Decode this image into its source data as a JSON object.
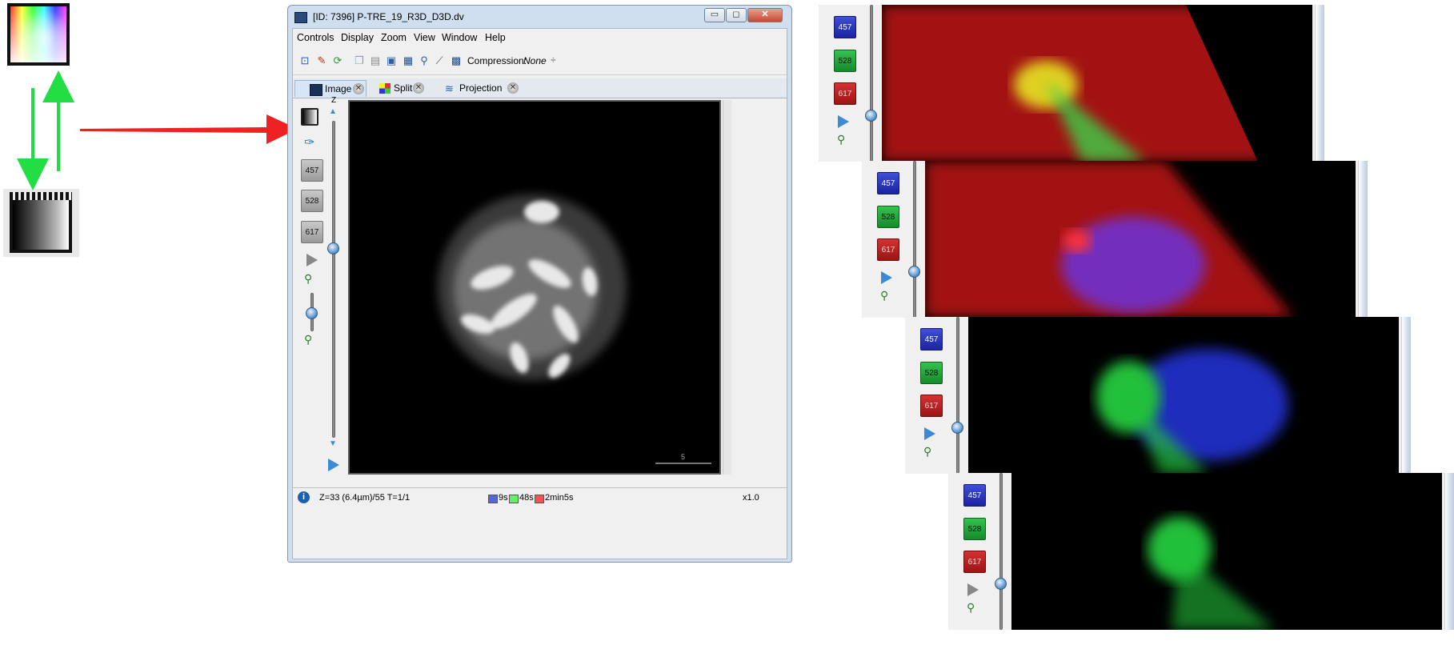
{
  "legend": {
    "color_mode_icon": "color-mode-icon",
    "grayscale_mode_icon": "grayscale-mode-icon",
    "arrow_colors": {
      "toggle": "#22dd44",
      "pointer": "#ee2222"
    }
  },
  "window": {
    "title": "[ID: 7396] P-TRE_19_R3D_D3D.dv",
    "controls": {
      "minimize": "▭",
      "maximize": "◻",
      "close": "✕"
    },
    "menu": [
      "Controls",
      "Display",
      "Zoom",
      "View",
      "Window",
      "Help"
    ],
    "toolbar": {
      "compression_label": "Compression:",
      "compression_value": "None",
      "compression_arrow": "÷"
    },
    "tabs": [
      {
        "label": "Image",
        "close": "✕"
      },
      {
        "label": "Split",
        "close": "✕"
      },
      {
        "label": "Projection",
        "close": "✕"
      }
    ],
    "z_label": "Z",
    "channels": [
      "457",
      "528",
      "617"
    ],
    "scalebar_label": "5",
    "status": {
      "position": "Z=33 (6.4µm)/55 T=1/1",
      "ch1_time": "9s",
      "ch2_time": "48s",
      "ch3_time": "2min5s",
      "zoom": "x1.0"
    },
    "channel_colors": {
      "blue": "#4a5ee8",
      "green": "#3fd85a",
      "red": "#e04040"
    }
  },
  "snapshots": [
    {
      "channels": [
        "457",
        "528",
        "617"
      ],
      "composite": "red-green"
    },
    {
      "channels": [
        "457",
        "528",
        "617"
      ],
      "composite": "red-blue"
    },
    {
      "channels": [
        "457",
        "528",
        "617"
      ],
      "composite": "green-blue"
    },
    {
      "channels": [
        "457",
        "528",
        "617"
      ],
      "composite": "green"
    }
  ]
}
